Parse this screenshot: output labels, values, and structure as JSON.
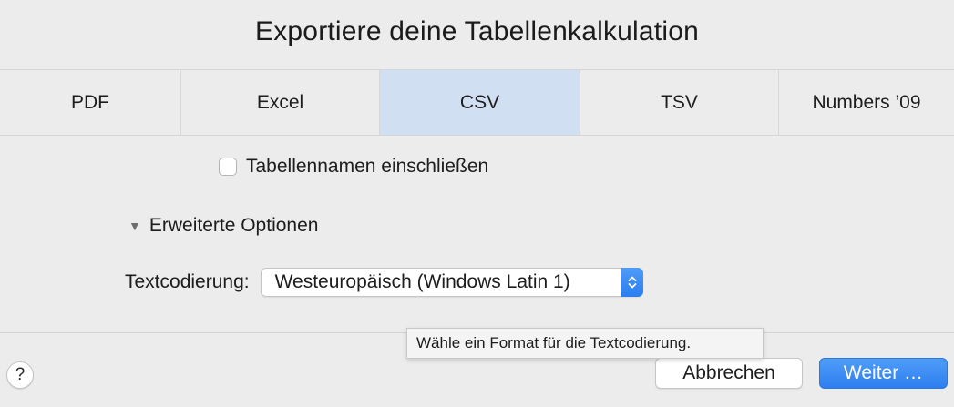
{
  "dialog": {
    "title": "Exportiere deine Tabellenkalkulation"
  },
  "tabs": [
    {
      "label": "PDF",
      "selected": false
    },
    {
      "label": "Excel",
      "selected": false
    },
    {
      "label": "CSV",
      "selected": true
    },
    {
      "label": "TSV",
      "selected": false
    },
    {
      "label": "Numbers ’09",
      "selected": false
    }
  ],
  "options": {
    "include_sheet_names_label": "Tabellennamen einschließen",
    "include_sheet_names_checked": false,
    "advanced_label": "Erweiterte Optionen",
    "advanced_expanded": true,
    "encoding_label": "Textcodierung:",
    "encoding_value": "Westeuropäisch (Windows Latin 1)"
  },
  "tooltip": {
    "text": "Wähle ein Format für die Textcodierung."
  },
  "footer": {
    "help_label": "?",
    "cancel_label": "Abbrechen",
    "next_label": "Weiter …"
  },
  "colors": {
    "selected_tab": "#d0dff1",
    "accent": "#2d7ff0",
    "background": "#ececec"
  },
  "icons": {
    "disclosure": "disclosure-triangle-down-icon",
    "stepper": "chevron-up-down-icon"
  }
}
